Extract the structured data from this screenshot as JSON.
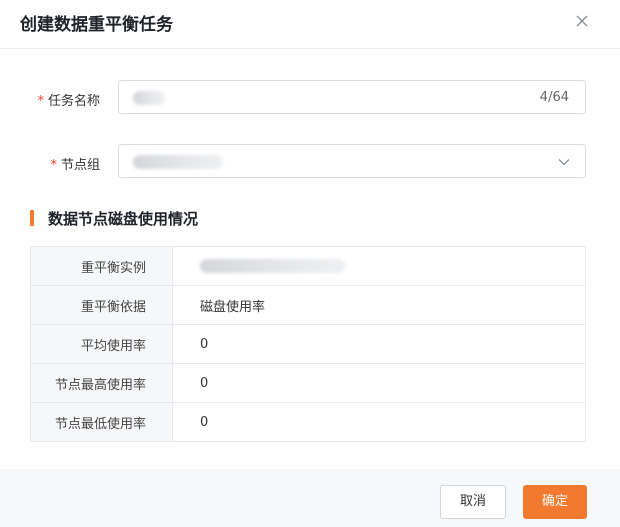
{
  "dialog": {
    "title": "创建数据重平衡任务",
    "close_icon": "close-icon"
  },
  "form": {
    "task_name": {
      "label": "任务名称",
      "required": true,
      "counter": "4/64"
    },
    "node_group": {
      "label": "节点组",
      "required": true,
      "icon": "chevron-down-icon"
    }
  },
  "section": {
    "title": "数据节点磁盘使用情况"
  },
  "table": {
    "rows": [
      {
        "label": "重平衡实例",
        "value": ""
      },
      {
        "label": "重平衡依据",
        "value": "磁盘使用率"
      },
      {
        "label": "平均使用率",
        "value": "0"
      },
      {
        "label": "节点最高使用率",
        "value": "0"
      },
      {
        "label": "节点最低使用率",
        "value": "0"
      }
    ]
  },
  "footer": {
    "cancel_label": "取消",
    "confirm_label": "确定"
  },
  "colors": {
    "accent": "#f27a2f",
    "required": "#f5412f"
  }
}
